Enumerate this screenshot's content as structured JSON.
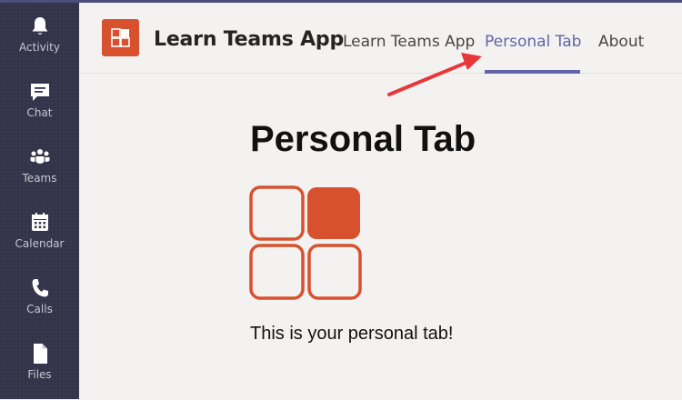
{
  "rail": {
    "items": [
      {
        "label": "Activity",
        "icon": "bell-icon"
      },
      {
        "label": "Chat",
        "icon": "chat-icon"
      },
      {
        "label": "Teams",
        "icon": "teams-icon"
      },
      {
        "label": "Calendar",
        "icon": "calendar-icon"
      },
      {
        "label": "Calls",
        "icon": "phone-icon"
      },
      {
        "label": "Files",
        "icon": "file-icon"
      }
    ]
  },
  "header": {
    "app_title": "Learn Teams App",
    "tabs": [
      {
        "label": "Learn Teams App",
        "active": false
      },
      {
        "label": "Personal Tab",
        "active": true
      },
      {
        "label": "About",
        "active": false
      }
    ]
  },
  "content": {
    "title": "Personal Tab",
    "message": "This is your personal tab!"
  },
  "colors": {
    "rail_background": "#33344a",
    "accent": "#6264a7",
    "brand": "#d8512f",
    "annotation_arrow": "#e8363a"
  }
}
